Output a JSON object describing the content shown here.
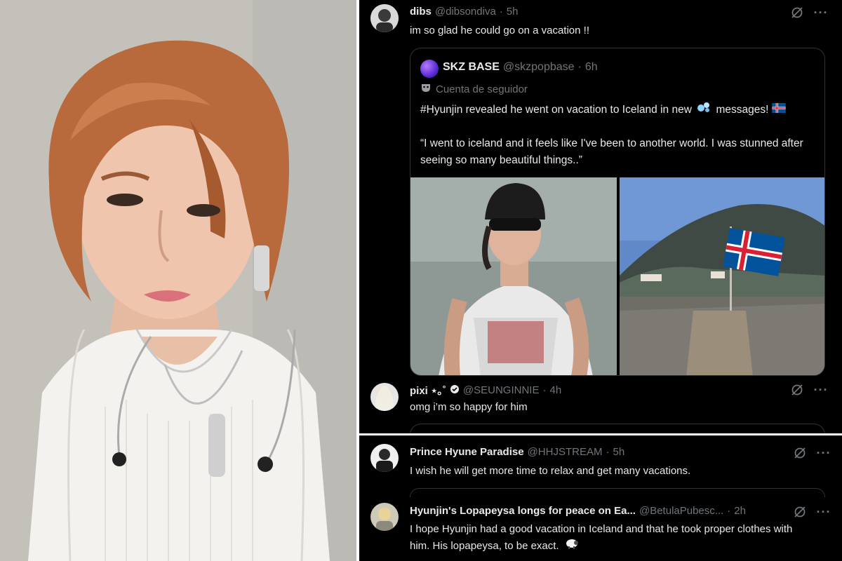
{
  "tweets": [
    {
      "display_name": "dibs",
      "handle": "@dibsondiva",
      "time": "5h",
      "text": "im so glad he could go on a vacation !!",
      "quote": {
        "display_name": "SKZ BASE",
        "handle": "@skzpopbase",
        "time": "6h",
        "badge": "Cuenta de seguidor",
        "text_line1": "#Hyunjin revealed he went on vacation to Iceland in new",
        "text_line1_end": "messages!",
        "text_line2": "“I went to iceland and it feels like I've been to another world. I was stunned after seeing so many beautiful things..”"
      }
    },
    {
      "display_name": "pixi ⋆｡˚",
      "handle": "@SEUNGINNIE",
      "time": "4h",
      "text": "omg i’m so happy for him"
    },
    {
      "display_name": "Prince Hyune Paradise",
      "handle": "@HHJSTREAM",
      "time": "5h",
      "text": "I wish he will get more time to relax and get many vacations."
    },
    {
      "display_name": "Hyunjin's Lopapeysa longs for peace on Ea...",
      "handle": "@BetulaPubesc...",
      "time": "2h",
      "text": "I hope Hyunjin had a good vacation in Iceland and that he took proper clothes with him. His lopapeysa, to be exact."
    }
  ],
  "separator": "·",
  "more_glyph": "···",
  "colors": {
    "background": "#000000",
    "text_primary": "#e7e9ea",
    "text_secondary": "#71767b",
    "border": "#2f3336",
    "iceland_blue": "#02529c",
    "iceland_red": "#dc1e35"
  },
  "icons": [
    "grok-icon",
    "more-icon",
    "bubbles-emoji-icon",
    "iceland-flag-icon",
    "mask-icon",
    "verified-icon",
    "sheep-emoji-icon"
  ]
}
